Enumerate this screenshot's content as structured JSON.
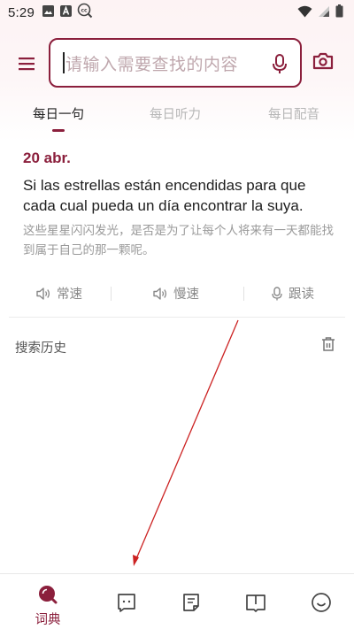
{
  "status_bar": {
    "time": "5:29",
    "left_icons": [
      "image-icon",
      "a-letter-icon",
      "cc-icon"
    ],
    "right_icons": [
      "wifi-icon",
      "signal-icon",
      "battery-icon"
    ]
  },
  "search": {
    "placeholder": "请输入需要查找的内容",
    "icons": [
      "menu-icon",
      "mic-icon",
      "camera-icon"
    ]
  },
  "tabs": [
    {
      "label": "每日一句",
      "active": true
    },
    {
      "label": "每日听力",
      "active": false
    },
    {
      "label": "每日配音",
      "active": false
    }
  ],
  "daily_sentence": {
    "date": "20 abr.",
    "text": "Si las estrellas están encendidas para que cada cual pueda un día encontrar la suya.",
    "translation": "这些星星闪闪发光，是否是为了让每个人将来有一天都能找到属于自己的那一颗呢。",
    "actions": [
      {
        "label": "常速",
        "icon": "speaker-icon"
      },
      {
        "label": "慢速",
        "icon": "speaker-icon"
      },
      {
        "label": "跟读",
        "icon": "mic-icon"
      }
    ]
  },
  "history": {
    "title": "搜索历史",
    "icon": "trash-icon"
  },
  "bottom_nav": [
    {
      "label": "词典",
      "icon": "search-icon",
      "active": true
    },
    {
      "label": "",
      "icon": "chat-icon",
      "active": false
    },
    {
      "label": "",
      "icon": "notes-icon",
      "active": false
    },
    {
      "label": "",
      "icon": "book-icon",
      "active": false
    },
    {
      "label": "",
      "icon": "smile-icon",
      "active": false
    }
  ],
  "colors": {
    "accent": "#8b1f3c",
    "annotation": "#cc2222"
  }
}
